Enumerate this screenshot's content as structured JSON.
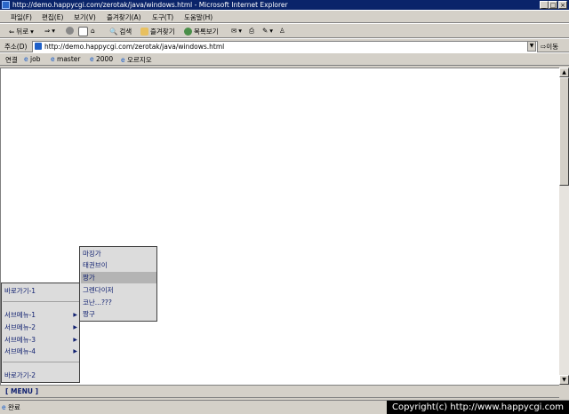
{
  "window": {
    "title": "http://demo.happycgi.com/zerotak/java/windows.html - Microsoft Internet Explorer"
  },
  "menubar": [
    "파일(F)",
    "편집(E)",
    "보기(V)",
    "즐겨찾기(A)",
    "도구(T)",
    "도움말(H)"
  ],
  "toolbar": {
    "back": "뒤로",
    "search": "검색",
    "favorites": "즐겨찾기",
    "history": "목록보기"
  },
  "address": {
    "label": "주소(D)",
    "url": "http://demo.happycgi.com/zerotak/java/windows.html",
    "go": "이동"
  },
  "links": {
    "label": "연결",
    "items": [
      "job",
      "master",
      "2000",
      "오르지오"
    ]
  },
  "bottom_menu": {
    "label": "[ MENU ]"
  },
  "main_menu": {
    "items": [
      {
        "label": "바로가기-1",
        "submenu": false
      },
      {
        "label": "서브메뉴-1",
        "submenu": true
      },
      {
        "label": "서브메뉴-2",
        "submenu": true
      },
      {
        "label": "서브메뉴-3",
        "submenu": true
      },
      {
        "label": "서브메뉴-4",
        "submenu": true
      },
      {
        "label": "바로가기-2",
        "submenu": false
      }
    ]
  },
  "submenu": {
    "items": [
      "마징가",
      "태권브이",
      "짱가",
      "그렌다이저",
      "코난...???",
      "짱구"
    ],
    "highlighted_index": 2
  },
  "status": {
    "text": "완료",
    "copyright": "Copyright(c) http://www.happycgi.com"
  },
  "colors": {
    "titlebar": "#0a246a",
    "chrome": "#d4d0c8",
    "menu_text": "#102070",
    "highlight": "#b4b4b4"
  }
}
